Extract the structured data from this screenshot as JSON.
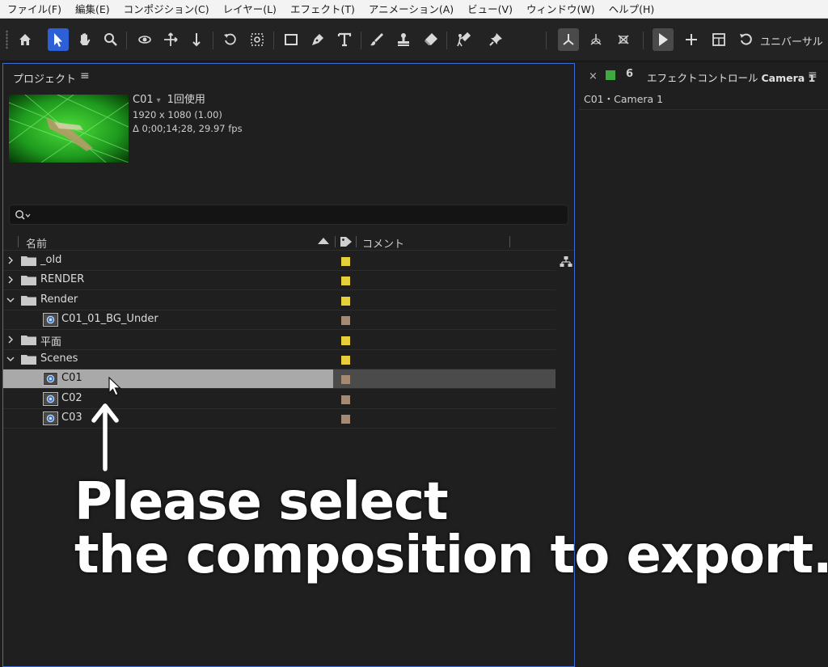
{
  "menu": [
    "ファイル(F)",
    "編集(E)",
    "コンポジション(C)",
    "レイヤー(L)",
    "エフェクト(T)",
    "アニメーション(A)",
    "ビュー(V)",
    "ウィンドウ(W)",
    "ヘルプ(H)"
  ],
  "toolbar": {
    "mode_label": "ユニバーサル",
    "tools": [
      "home-icon",
      "selection-tool-icon",
      "hand-tool-icon",
      "zoom-tool-icon",
      "orbit-camera-icon",
      "pan-camera-icon",
      "dolly-camera-icon",
      "rotate-tool-icon",
      "pan-behind-icon",
      "rectangle-tool-icon",
      "pen-tool-icon",
      "type-tool-icon",
      "brush-tool-icon",
      "clone-stamp-icon",
      "eraser-icon",
      "roto-brush-icon",
      "puppet-pin-icon",
      "local-axis-icon",
      "world-axis-icon",
      "view-axis-icon",
      "snap-arrow-icon",
      "plus-icon",
      "box-icon",
      "undo-circle-icon"
    ]
  },
  "project": {
    "title": "プロジェクト",
    "menu_glyph": "≡",
    "selected_name": "C01",
    "usage": "1回使用",
    "dimensions": "1920 x 1080 (1.00)",
    "duration": "Δ 0;00;14;28, 29.97 fps",
    "columns": {
      "name": "名前",
      "comment": "コメント"
    },
    "rows": [
      {
        "label": "_old",
        "type": "folder",
        "expanded": false,
        "indent": 0,
        "color": "#e6cf3a"
      },
      {
        "label": "RENDER",
        "type": "folder",
        "expanded": false,
        "indent": 0,
        "color": "#e6cf3a"
      },
      {
        "label": "Render",
        "type": "folder",
        "expanded": true,
        "indent": 0,
        "color": "#e6cf3a"
      },
      {
        "label": "C01_01_BG_Under",
        "type": "comp",
        "indent": 1,
        "color": "#a48a73"
      },
      {
        "label": "平面",
        "type": "folder",
        "expanded": false,
        "indent": 0,
        "color": "#e6cf3a"
      },
      {
        "label": "Scenes",
        "type": "folder",
        "expanded": true,
        "indent": 0,
        "color": "#e6cf3a"
      },
      {
        "label": "C01",
        "type": "comp",
        "indent": 1,
        "color": "#a48a73",
        "selected": true
      },
      {
        "label": "C02",
        "type": "comp",
        "indent": 1,
        "color": "#a48a73"
      },
      {
        "label": "C03",
        "type": "comp",
        "indent": 1,
        "color": "#a48a73"
      }
    ]
  },
  "effects": {
    "close": "×",
    "lock": "6",
    "title": "エフェクトコントロール",
    "title_layer": "Camera 1",
    "menu_glyph": "≡",
    "subtitle": "C01・Camera 1"
  },
  "annotation": {
    "line1": "Please select",
    "line2": "the composition to export."
  }
}
